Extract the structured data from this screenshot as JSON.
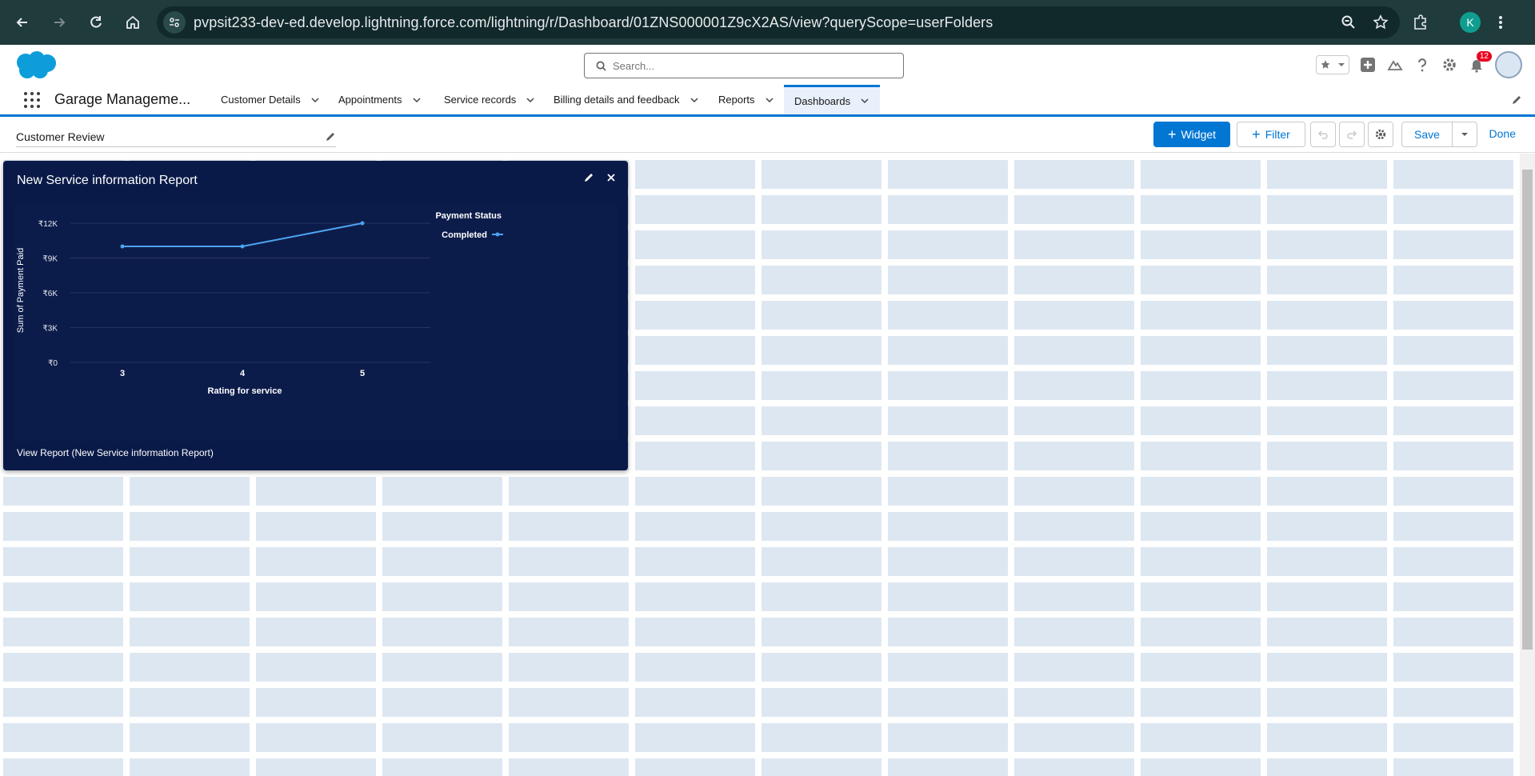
{
  "browser": {
    "url": "pvpsit233-dev-ed.develop.lightning.force.com/lightning/r/Dashboard/01ZNS000001Z9cX2AS/view?queryScope=userFolders",
    "profile_initial": "K"
  },
  "header": {
    "search_placeholder": "Search...",
    "notifications_count": "12"
  },
  "app": {
    "name": "Garage Manageme...",
    "tabs": [
      {
        "label": "Customer Details"
      },
      {
        "label": "Appointments"
      },
      {
        "label": "Service records"
      },
      {
        "label": "Billing details and feedback"
      },
      {
        "label": "Reports"
      },
      {
        "label": "Dashboards",
        "active": true
      }
    ]
  },
  "builder": {
    "dashboard_name": "Customer Review",
    "widget_label": "Widget",
    "filter_label": "Filter",
    "save_label": "Save",
    "done_label": "Done"
  },
  "widget": {
    "title": "New Service information Report",
    "footer_link": "View Report (New Service information Report)"
  },
  "chart_data": {
    "type": "line",
    "title": "New Service information Report",
    "xlabel": "Rating for service",
    "ylabel": "Sum of Payment Paid",
    "categories": [
      "3",
      "4",
      "5"
    ],
    "series": [
      {
        "name": "Completed",
        "values": [
          10000,
          10000,
          12000
        ]
      }
    ],
    "legend_title": "Payment Status",
    "legend_position": "top-right",
    "y_ticks": [
      "₹0",
      "₹3K",
      "₹6K",
      "₹9K",
      "₹12K"
    ],
    "y_tick_values": [
      0,
      3000,
      6000,
      9000,
      12000
    ],
    "ylim": [
      0,
      12000
    ],
    "grid": true,
    "colors": {
      "line": "#4ea3f0",
      "background": "#0c1c4a"
    }
  }
}
